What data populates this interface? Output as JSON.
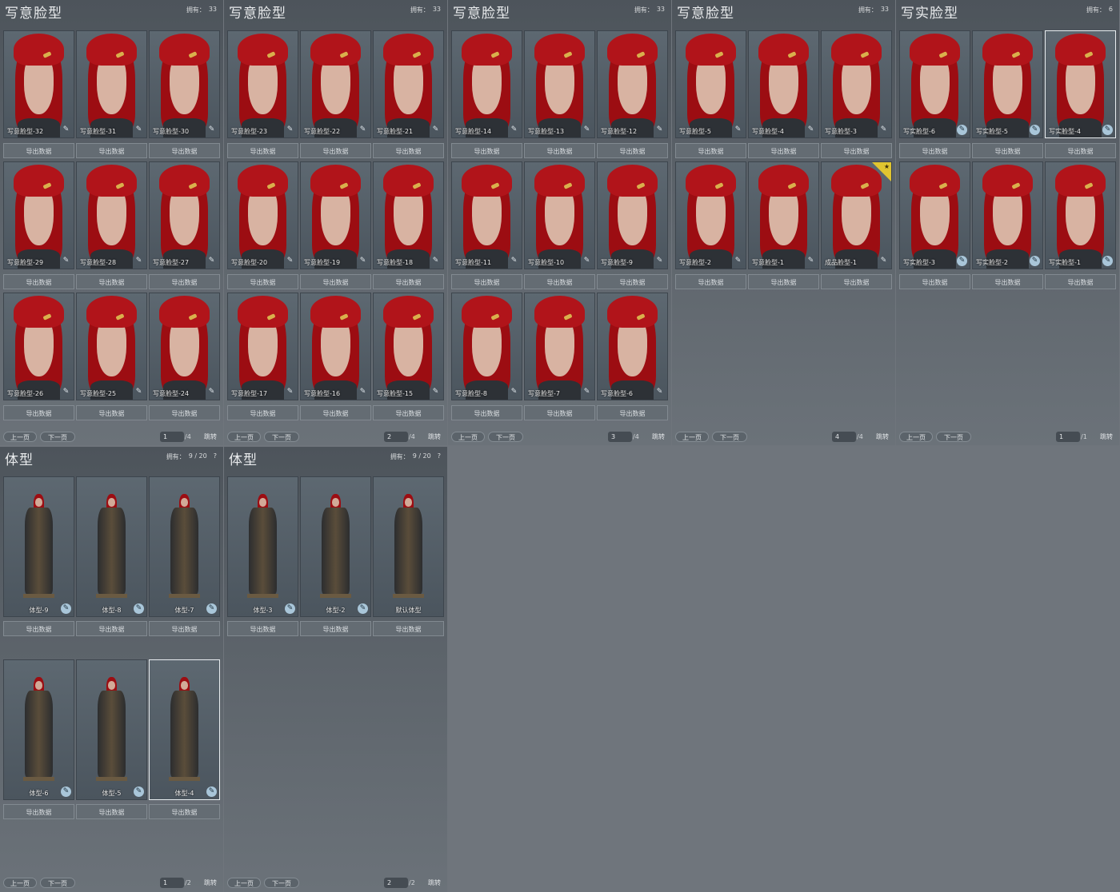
{
  "labels": {
    "export": "导出数据",
    "prev": "上一页",
    "next": "下一页",
    "jump": "跳转",
    "owned": "拥有：",
    "help": "?"
  },
  "icons": {
    "edit": "edit-pen-icon",
    "new": "new-corner-badge-icon"
  },
  "colors": {
    "background": "#6f757c",
    "panel": "#5c636a",
    "hair": "#9c0d12",
    "badge": "#e0c530",
    "edit_icon": "#a9c6d9"
  },
  "face_panels": [
    {
      "title": "写意脸型",
      "owned": "33",
      "page": "1",
      "total": "/4",
      "cards": [
        {
          "label": "写意脸型-32",
          "status": "faint"
        },
        {
          "label": "写意脸型-31",
          "status": "faint"
        },
        {
          "label": "写意脸型-30",
          "status": "faint"
        },
        {
          "label": "写意脸型-29",
          "status": "faint"
        },
        {
          "label": "写意脸型-28",
          "status": "faint"
        },
        {
          "label": "写意脸型-27",
          "status": "faint"
        },
        {
          "label": "写意脸型-26",
          "status": "faint"
        },
        {
          "label": "写意脸型-25",
          "status": "faint"
        },
        {
          "label": "写意脸型-24",
          "status": "faint"
        }
      ]
    },
    {
      "title": "写意脸型",
      "owned": "33",
      "page": "2",
      "total": "/4",
      "cards": [
        {
          "label": "写意脸型-23",
          "status": "faint"
        },
        {
          "label": "写意脸型-22",
          "status": "faint"
        },
        {
          "label": "写意脸型-21",
          "status": "faint"
        },
        {
          "label": "写意脸型-20",
          "status": "faint"
        },
        {
          "label": "写意脸型-19",
          "status": "faint"
        },
        {
          "label": "写意脸型-18",
          "status": "faint"
        },
        {
          "label": "写意脸型-17",
          "status": "faint"
        },
        {
          "label": "写意脸型-16",
          "status": "faint"
        },
        {
          "label": "写意脸型-15",
          "status": "faint"
        }
      ]
    },
    {
      "title": "写意脸型",
      "owned": "33",
      "page": "3",
      "total": "/4",
      "cards": [
        {
          "label": "写意脸型-14",
          "status": "faint"
        },
        {
          "label": "写意脸型-13",
          "status": "faint"
        },
        {
          "label": "写意脸型-12",
          "status": "faint"
        },
        {
          "label": "写意脸型-11",
          "status": "faint"
        },
        {
          "label": "写意脸型-10",
          "status": "faint"
        },
        {
          "label": "写意脸型-9",
          "status": "faint"
        },
        {
          "label": "写意脸型-8",
          "status": "faint"
        },
        {
          "label": "写意脸型-7",
          "status": "faint"
        },
        {
          "label": "写意脸型-6",
          "status": "faint"
        }
      ]
    },
    {
      "title": "写意脸型",
      "owned": "33",
      "page": "4",
      "total": "/4",
      "cards": [
        {
          "label": "写意脸型-5",
          "status": "faint"
        },
        {
          "label": "写意脸型-4",
          "status": "faint"
        },
        {
          "label": "写意脸型-3",
          "status": "faint"
        },
        {
          "label": "写意脸型-2",
          "status": "faint"
        },
        {
          "label": "写意脸型-1",
          "status": "faint"
        },
        {
          "label": "成品脸型-1",
          "status": "faint",
          "badge": true
        }
      ]
    },
    {
      "title": "写实脸型",
      "owned": "6",
      "page": "1",
      "total": "/1",
      "cards": [
        {
          "label": "写实脸型-6",
          "status": "edit"
        },
        {
          "label": "写实脸型-5",
          "status": "edit"
        },
        {
          "label": "写实脸型-4",
          "status": "edit",
          "selected": true
        },
        {
          "label": "写实脸型-3",
          "status": "edit"
        },
        {
          "label": "写实脸型-2",
          "status": "edit"
        },
        {
          "label": "写实脸型-1",
          "status": "edit"
        }
      ]
    }
  ],
  "body_panels": [
    {
      "title": "体型",
      "owned": "9 / 20",
      "page": "1",
      "total": "/2",
      "cards": [
        {
          "label": "体型-9",
          "status": "edit"
        },
        {
          "label": "体型-8",
          "status": "edit"
        },
        {
          "label": "体型-7",
          "status": "edit"
        },
        {
          "label": "体型-6",
          "status": "edit"
        },
        {
          "label": "体型-5",
          "status": "edit"
        },
        {
          "label": "体型-4",
          "status": "edit",
          "selected": true
        }
      ]
    },
    {
      "title": "体型",
      "owned": "9 / 20",
      "page": "2",
      "total": "/2",
      "cards": [
        {
          "label": "体型-3",
          "status": "edit"
        },
        {
          "label": "体型-2",
          "status": "edit"
        },
        {
          "label": "默认体型",
          "status": "none"
        }
      ]
    }
  ]
}
